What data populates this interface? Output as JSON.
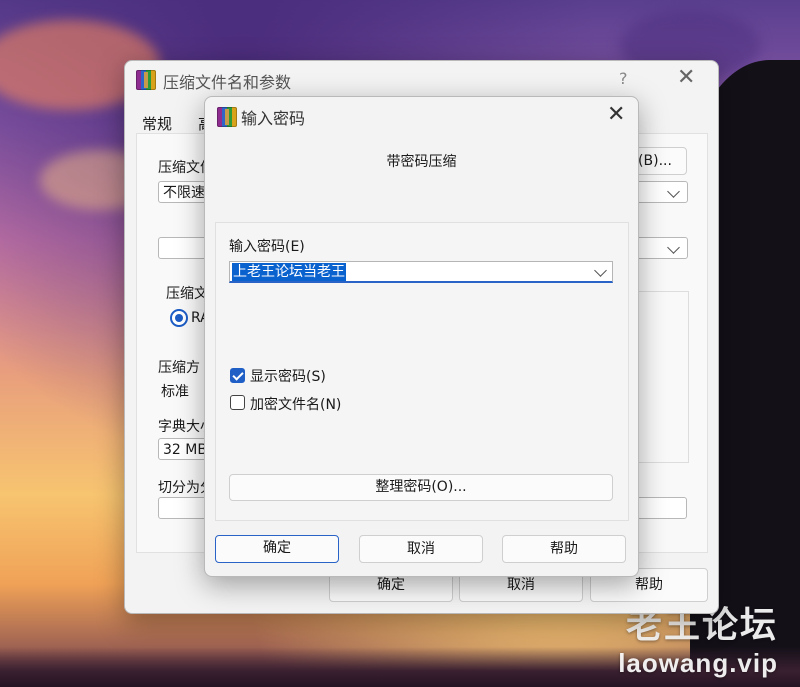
{
  "background_window": {
    "title": "压缩文件名和参数",
    "help_glyph": "?",
    "close_glyph": "✕",
    "tabs": [
      "常规",
      "高"
    ],
    "labels": {
      "archive_name": "压缩文件",
      "format": "压缩文",
      "format_option": "RA",
      "method": "压缩方",
      "dict": "字典大小",
      "split": "切分为分"
    },
    "values": {
      "update_mode": "不限速",
      "method": "标准",
      "dict": "32 MB"
    },
    "browse_button": "(B)...",
    "buttons": {
      "ok": "确定",
      "cancel": "取消",
      "help": "帮助"
    }
  },
  "dialog": {
    "title": "输入密码",
    "close_glyph": "✕",
    "subtitle": "带密码压缩",
    "password_label": "输入密码(E)",
    "password_value": "上老王论坛当老王",
    "show_password": {
      "label": "显示密码(S)",
      "checked": true
    },
    "encrypt_names": {
      "label": "加密文件名(N)",
      "checked": false
    },
    "organize_button": "整理密码(O)...",
    "buttons": {
      "ok": "确定",
      "cancel": "取消",
      "help": "帮助"
    }
  },
  "watermark": {
    "name": "老王论坛",
    "url": "laowang.vip"
  },
  "icons": {
    "app": "winrar-icon",
    "dropdown": "chevron-down-icon",
    "close": "close-icon",
    "check": "check-icon"
  },
  "colors": {
    "accent": "#1f5fc6",
    "selection": "#0a62cf"
  }
}
